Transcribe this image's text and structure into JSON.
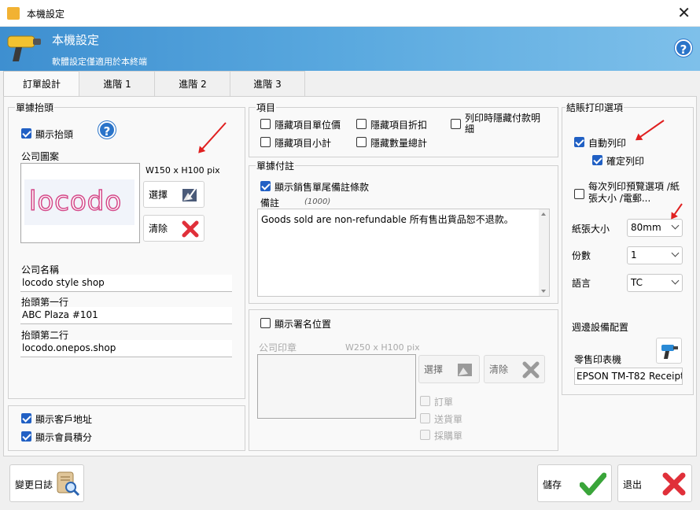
{
  "window": {
    "title": "本機設定",
    "close_glyph": "✕"
  },
  "banner": {
    "title": "本機設定",
    "subtitle": "軟體設定僅適用於本終端",
    "help_glyph": "?"
  },
  "tabs": [
    {
      "label": "訂單設計"
    },
    {
      "label": "進階 1"
    },
    {
      "label": "進階 2"
    },
    {
      "label": "進階 3"
    }
  ],
  "header_group": {
    "title": "單據抬頭",
    "show_header": "顯示抬頭",
    "help_glyph": "?",
    "logo_label": "公司圖案",
    "logo_size": "W150 x H100 pix",
    "logo_text": "locodo",
    "select_button": "選擇",
    "clear_button": "清除",
    "company_name_label": "公司名稱",
    "company_name_value": "locodo style shop",
    "line1_label": "抬頭第一行",
    "line1_value": "ABC Plaza #101",
    "line2_label": "抬頭第二行",
    "line2_value": "locodo.onepos.shop"
  },
  "customer_group": {
    "show_address": "顯示客戶地址",
    "show_points": "顯示會員積分"
  },
  "items_group": {
    "title": "項目",
    "hide_unit_price": "隱藏項目單位價",
    "hide_discount": "隱藏項目折扣",
    "hide_payment_details": "列印時隱藏付款明細",
    "hide_subtotal": "隱藏項目小計",
    "hide_qty_total": "隱藏數量總計"
  },
  "footer_note_group": {
    "title": "單據付註",
    "show_note": "顯示銷售單尾備註條款",
    "note_label": "備註",
    "note_limit": "(1000)",
    "note_text": "Goods sold are non-refundable  所有售出貨品恕不退款。"
  },
  "signature_group": {
    "show_signature": "顯示署名位置",
    "stamp_label": "公司印章",
    "stamp_size": "W250 x H100 pix",
    "select_button": "選擇",
    "clear_button": "清除",
    "order": "訂單",
    "delivery": "送貨單",
    "purchase": "採購單"
  },
  "checkout_group": {
    "title": "結賬打印選項",
    "auto_print": "自動列印",
    "confirm_print": "確定列印",
    "preview_options": "每次列印預覽選項 /紙張大小 /電郵...",
    "paper_size_label": "紙張大小",
    "paper_size_value": "80mm",
    "copies_label": "份數",
    "copies_value": "1",
    "language_label": "語言",
    "language_value": "TC",
    "device_label": "週邊設備配置",
    "printer_label": "零售印表機",
    "printer_value": "EPSON TM-T82 Receipt"
  },
  "footer": {
    "changelog_button": "變更日誌",
    "save_button": "儲存",
    "exit_button": "退出"
  },
  "colors": {
    "accent": "#2160c4",
    "banner": "#4a9bd6",
    "save_check": "#3aa53a",
    "exit_x": "#e0303a",
    "arrow": "#e02020"
  }
}
